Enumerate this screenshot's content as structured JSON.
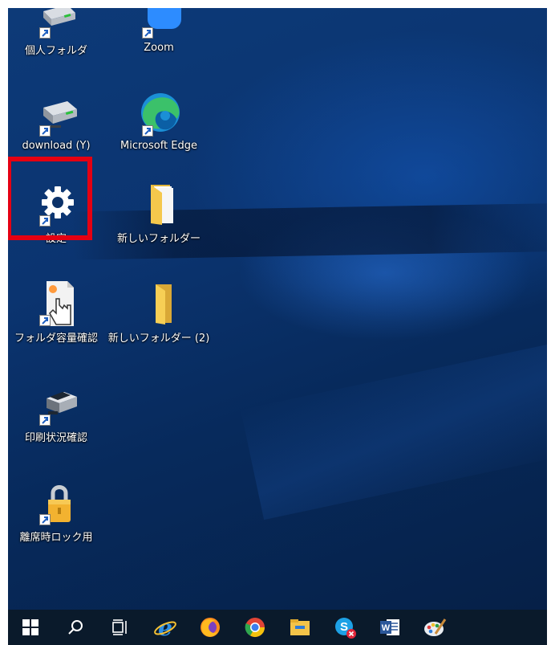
{
  "desktop": {
    "icons": [
      {
        "label": "個人フォルダ",
        "icon": "drive-icon"
      },
      {
        "label": "Zoom",
        "icon": "zoom-icon"
      },
      {
        "label": "download (Y)",
        "icon": "network-drive-icon"
      },
      {
        "label": "Microsoft Edge",
        "icon": "edge-icon"
      },
      {
        "label": "設定",
        "icon": "gear-icon"
      },
      {
        "label": "新しいフォルダー",
        "icon": "folder-icon"
      },
      {
        "label": "フォルダ容量確認",
        "icon": "document-hand-icon"
      },
      {
        "label": "新しいフォルダー (2)",
        "icon": "folder-icon"
      },
      {
        "label": "印刷状況確認",
        "icon": "printer-icon"
      },
      {
        "label": "離席時ロック用",
        "icon": "lock-icon"
      }
    ],
    "highlight_color": "#e50012"
  },
  "taskbar": {
    "items": [
      "windows-start-icon",
      "search-icon",
      "task-view-icon",
      "internet-explorer-icon",
      "firefox-icon",
      "chrome-icon",
      "file-explorer-icon",
      "skype-icon",
      "word-icon",
      "paint-icon"
    ]
  }
}
